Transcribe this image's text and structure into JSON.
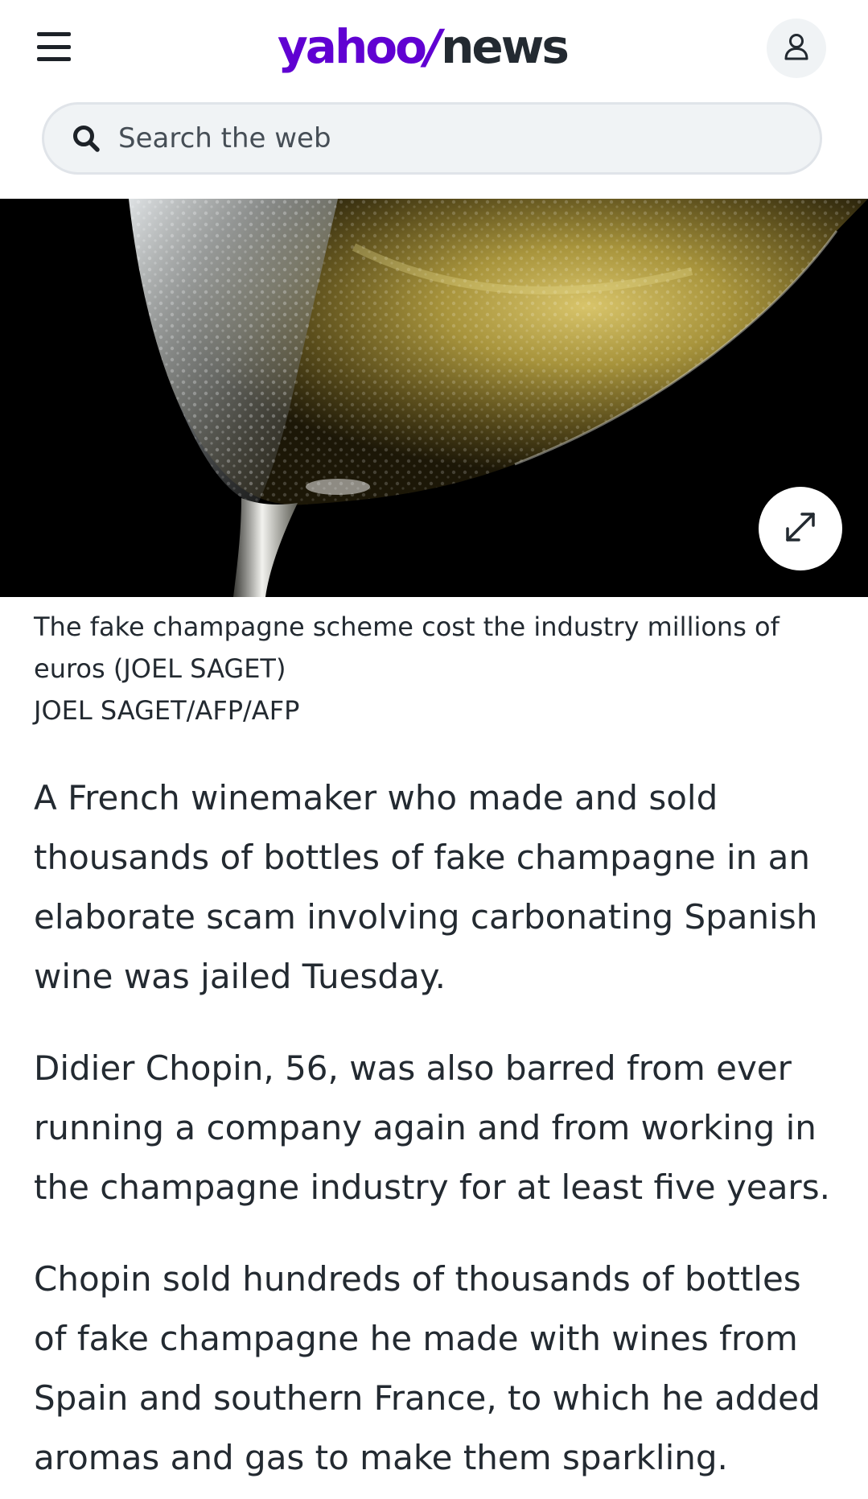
{
  "header": {
    "menu_icon": "hamburger-menu-icon",
    "logo_yahoo": "yahoo",
    "logo_slash": "/",
    "logo_news": "news",
    "account_icon": "user-icon"
  },
  "search": {
    "placeholder": "Search the web",
    "icon": "search-icon"
  },
  "hero": {
    "expand_icon": "expand-icon"
  },
  "caption": {
    "text": "The fake champagne scheme cost the industry millions of euros (JOEL SAGET)",
    "credit": "JOEL SAGET/AFP/AFP"
  },
  "article": {
    "paragraphs": [
      "A French winemaker who made and sold thousands of bottles of fake champagne in an elaborate scam involving carbonating Spanish wine was jailed Tuesday.",
      "Didier Chopin, 56, was also barred from ever running a company again and from working in the champagne industry for at least five years.",
      "Chopin sold hundreds of thousands of bottles of fake champagne he made with wines from Spain and southern France, to which he added aromas and gas to make them sparkling."
    ]
  },
  "colors": {
    "brand_purple": "#6001d2",
    "text_dark": "#232a31",
    "search_bg": "#f0f3f5"
  }
}
